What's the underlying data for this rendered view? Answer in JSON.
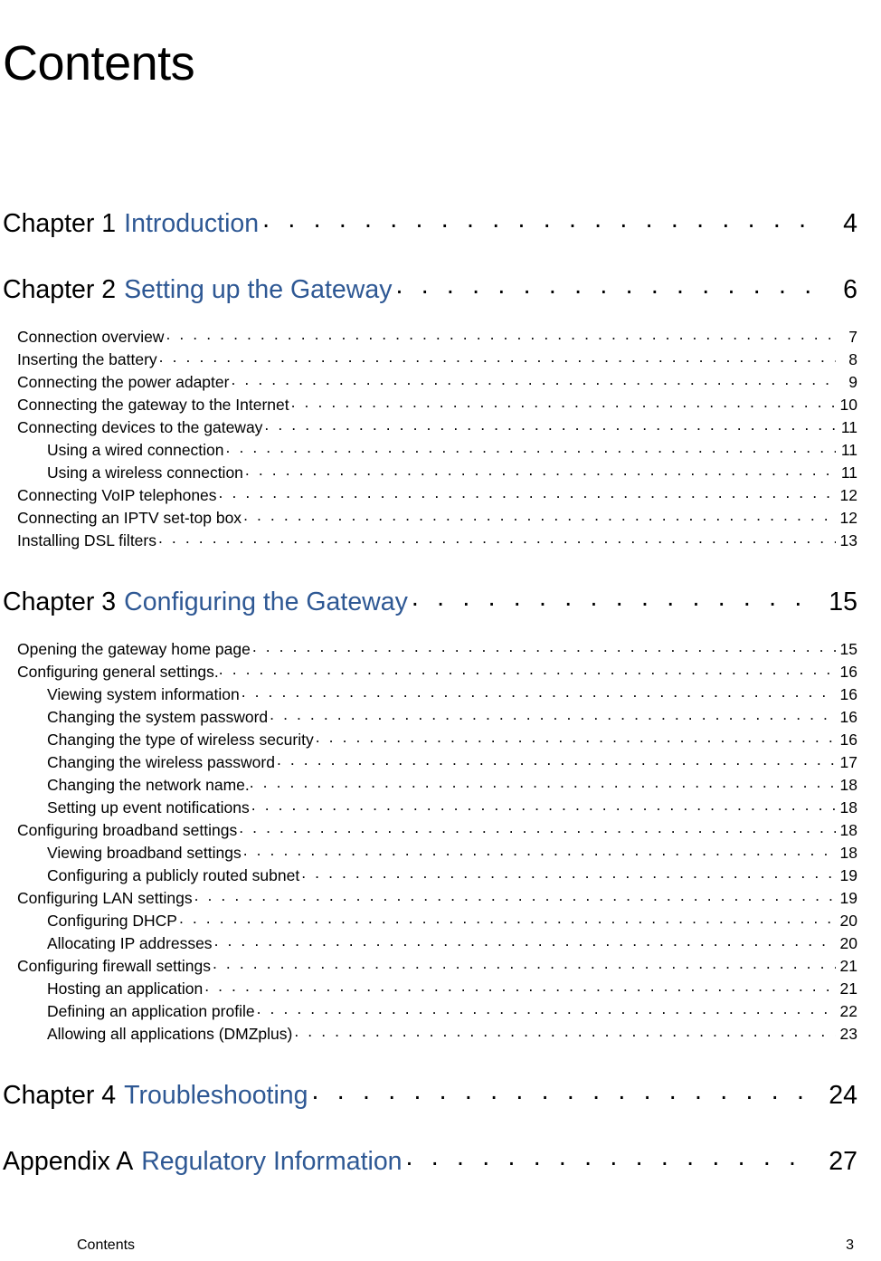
{
  "document": {
    "title": "Contents",
    "accent_color": "#2E5894",
    "text_color": "#000000"
  },
  "toc": {
    "chapters": [
      {
        "label": "Chapter 1",
        "title": "Introduction",
        "page": "4",
        "entries": []
      },
      {
        "label": "Chapter 2",
        "title": "Setting up the Gateway",
        "page": "6",
        "entries": [
          {
            "level": 1,
            "text": "Connection overview",
            "page": "7"
          },
          {
            "level": 1,
            "text": "Inserting the battery",
            "page": "8"
          },
          {
            "level": 1,
            "text": "Connecting the power adapter",
            "page": "9"
          },
          {
            "level": 1,
            "text": "Connecting the gateway to the Internet",
            "page": "10"
          },
          {
            "level": 1,
            "text": "Connecting devices to the gateway",
            "page": "11"
          },
          {
            "level": 2,
            "text": "Using a wired connection",
            "page": "11"
          },
          {
            "level": 2,
            "text": "Using a wireless connection",
            "page": "11"
          },
          {
            "level": 1,
            "text": "Connecting VoIP telephones",
            "page": "12"
          },
          {
            "level": 1,
            "text": "Connecting an IPTV set-top box",
            "page": "12"
          },
          {
            "level": 1,
            "text": "Installing DSL filters",
            "page": "13"
          }
        ]
      },
      {
        "label": "Chapter 3",
        "title": "Configuring the Gateway",
        "page": "15",
        "entries": [
          {
            "level": 1,
            "text": "Opening the gateway home page",
            "page": "15"
          },
          {
            "level": 1,
            "text": "Configuring general settings.",
            "page": "16"
          },
          {
            "level": 2,
            "text": "Viewing system information",
            "page": "16"
          },
          {
            "level": 2,
            "text": "Changing the system password",
            "page": "16"
          },
          {
            "level": 2,
            "text": "Changing the type of wireless security",
            "page": "16"
          },
          {
            "level": 2,
            "text": "Changing the wireless password",
            "page": "17"
          },
          {
            "level": 2,
            "text": "Changing the network name.",
            "page": "18"
          },
          {
            "level": 2,
            "text": "Setting up event notifications",
            "page": "18"
          },
          {
            "level": 1,
            "text": "Configuring broadband settings",
            "page": "18"
          },
          {
            "level": 2,
            "text": "Viewing broadband settings",
            "page": "18"
          },
          {
            "level": 2,
            "text": "Configuring a publicly routed subnet",
            "page": "19"
          },
          {
            "level": 1,
            "text": "Configuring LAN settings",
            "page": "19"
          },
          {
            "level": 2,
            "text": "Configuring DHCP",
            "page": "20"
          },
          {
            "level": 2,
            "text": "Allocating IP addresses",
            "page": "20"
          },
          {
            "level": 1,
            "text": "Configuring firewall settings",
            "page": "21"
          },
          {
            "level": 2,
            "text": "Hosting an application",
            "page": "21"
          },
          {
            "level": 2,
            "text": "Defining an application profile",
            "page": "22"
          },
          {
            "level": 2,
            "text": "Allowing all applications (DMZplus)",
            "page": "23"
          }
        ]
      },
      {
        "label": "Chapter 4",
        "title": "Troubleshooting",
        "page": "24",
        "entries": []
      },
      {
        "label": "Appendix A",
        "title": "Regulatory Information",
        "page": "27",
        "entries": []
      }
    ]
  },
  "footer": {
    "left": "Contents",
    "page_number": "3"
  }
}
